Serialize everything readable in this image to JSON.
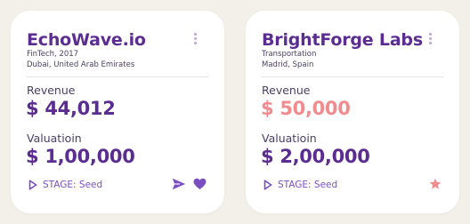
{
  "colors": {
    "primary": "#5b2d91",
    "accent": "#7b4fc2",
    "highlight": "#f28b8e",
    "background": "#f3efe9",
    "card": "#ffffff"
  },
  "cards": [
    {
      "name": "EchoWave.io",
      "industry_year": "FinTech, 2017",
      "location": "Dubai, United Arab Emirates",
      "revenue_label": "Revenue",
      "revenue_value": "$ 44,012",
      "valuation_label": "Valuatioin",
      "valuation_value": "$ 1,00,000",
      "stage_label": "STAGE: Seed",
      "actions": [
        "send-icon",
        "heart-icon"
      ]
    },
    {
      "name": "BrightForge Labs",
      "industry_year": "Transportation",
      "location": "Madrid, Spain",
      "revenue_label": "Revenue",
      "revenue_value": "$ 50,000",
      "valuation_label": "Valuatioin",
      "valuation_value": "$ 2,00,000",
      "stage_label": "STAGE: Seed",
      "actions": [
        "star-icon"
      ]
    }
  ]
}
